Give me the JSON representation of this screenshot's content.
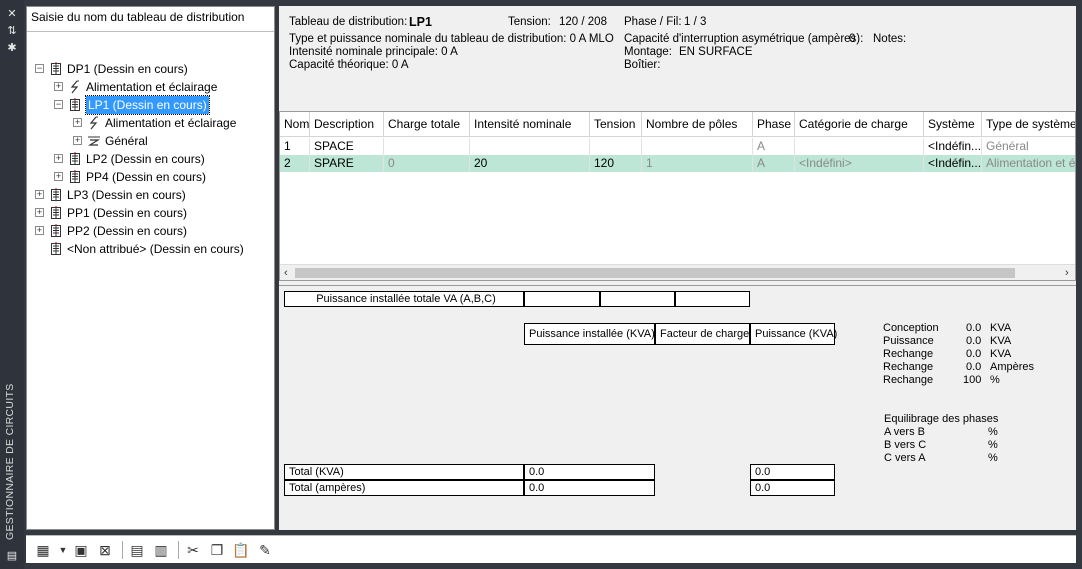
{
  "app": {
    "vertical_title": "GESTIONNAIRE DE CIRCUITS"
  },
  "left_panel": {
    "header": "Saisie du nom du tableau de distribution",
    "tree": [
      {
        "id": "dp1",
        "label": "DP1 (Dessin en cours)",
        "expand": "-",
        "icon": "panel-icon"
      },
      {
        "id": "dp1-alim",
        "label": "Alimentation et éclairage",
        "expand": "+",
        "icon": "lightning-icon"
      },
      {
        "id": "lp1",
        "label": "LP1 (Dessin en cours)",
        "expand": "-",
        "icon": "panel-icon",
        "selected": true
      },
      {
        "id": "lp1-alim",
        "label": "Alimentation et éclairage",
        "expand": "+",
        "icon": "lightning-icon"
      },
      {
        "id": "lp1-gen",
        "label": "Général",
        "expand": "+",
        "icon": "general-load-icon"
      },
      {
        "id": "lp2",
        "label": "LP2 (Dessin en cours)",
        "expand": "+",
        "icon": "panel-icon"
      },
      {
        "id": "pp4",
        "label": "PP4 (Dessin en cours)",
        "expand": "+",
        "icon": "panel-icon"
      },
      {
        "id": "lp3",
        "label": "LP3 (Dessin en cours)",
        "expand": "+",
        "icon": "panel-icon"
      },
      {
        "id": "pp1",
        "label": "PP1 (Dessin en cours)",
        "expand": "+",
        "icon": "panel-icon"
      },
      {
        "id": "pp2",
        "label": "PP2 (Dessin en cours)",
        "expand": "+",
        "icon": "panel-icon"
      },
      {
        "id": "na",
        "label": "<Non attribué> (Dessin en cours)",
        "expand": "",
        "icon": "panel-icon"
      }
    ]
  },
  "info": {
    "panel_label": "Tableau de distribution:",
    "panel_name": "LP1",
    "voltage_label": "Tension:",
    "voltage_value": "120 / 208",
    "phase_label": "Phase / Fil:",
    "phase_value": "1 /  3",
    "type_line": "Type et puissance nominale du tableau de distribution: 0 A MLO",
    "current_line": "Intensité nominale principale: 0 A",
    "capacity_line": "Capacité théorique: 0 A",
    "interrupt_label": "Capacité d'interruption asymétrique (ampères):",
    "interrupt_value": "0",
    "notes_label": "Notes:",
    "mount_label": "Montage:",
    "mount_value": "EN SURFACE",
    "box_label": "Boîtier:"
  },
  "grid": {
    "columns": [
      "Nom",
      "Description",
      "Charge totale",
      "Intensité nominale",
      "Tension",
      "Nombre de pôles",
      "Phase",
      "Catégorie de charge",
      "Système",
      "Type de système"
    ],
    "rows": [
      [
        "1",
        "SPACE",
        "",
        "",
        "",
        "",
        "A",
        "",
        "<Indéfin...",
        "Général"
      ],
      [
        "2",
        "SPARE",
        "0",
        "20",
        "120",
        "1",
        "A",
        "<Indéfini>",
        "<Indéfin...",
        "Alimentation et é"
      ]
    ]
  },
  "summary": {
    "total_va_label": "Puissance installée totale VA (A,B,C)",
    "col_installed": "Puissance installée (KVA)",
    "col_factor": "Facteur de charge",
    "col_power": "Puissance (KVA)",
    "total_kva_label": "Total (KVA)",
    "total_kva_value": "0.0",
    "total_kva_power": "0.0",
    "total_amp_label": "Total (ampères)",
    "total_amp_value": "0.0",
    "total_amp_power": "0.0",
    "stats": [
      {
        "label": "Conception",
        "value": "0.0",
        "unit": "KVA"
      },
      {
        "label": "Puissance",
        "value": "0.0",
        "unit": "KVA"
      },
      {
        "label": "Rechange",
        "value": "0.0",
        "unit": "KVA"
      },
      {
        "label": "Rechange",
        "value": "0.0",
        "unit": "Ampères"
      },
      {
        "label": "Rechange",
        "value": "100",
        "unit": "%"
      }
    ],
    "balance_title": "Equilibrage des phases",
    "balance": [
      {
        "label": "A vers B",
        "unit": "%"
      },
      {
        "label": "B vers C",
        "unit": "%"
      },
      {
        "label": "C vers A",
        "unit": "%"
      }
    ]
  }
}
